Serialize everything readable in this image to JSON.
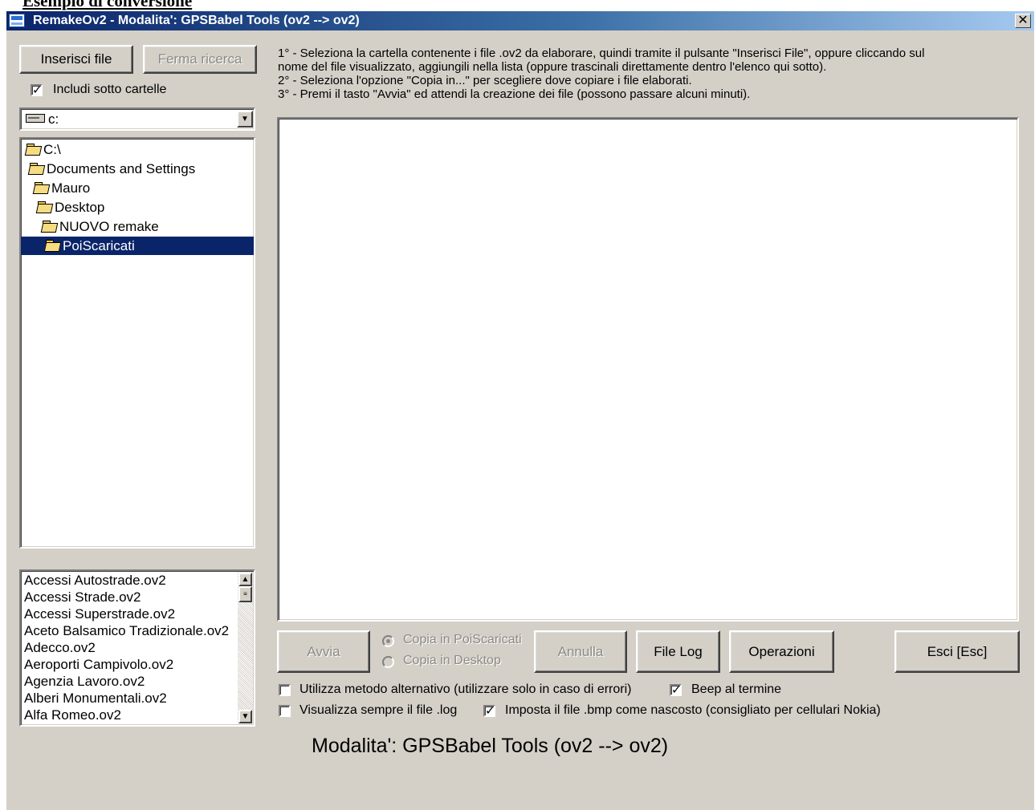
{
  "document": {
    "heading_fragment": "Esempio di conversione"
  },
  "window": {
    "title": "RemakeOv2 - Modalita': GPSBabel Tools (ov2 --> ov2)",
    "close_label": "✕"
  },
  "left_panel": {
    "insert_button": "Inserisci file",
    "stop_button": "Ferma ricerca",
    "include_subfolders": {
      "label": "Includi sotto cartelle",
      "checked": true
    },
    "drive_select": {
      "value": "c:",
      "options_visible": [
        "c:"
      ]
    },
    "folder_tree": [
      {
        "label": "C:\\",
        "selected": false
      },
      {
        "label": "Documents and Settings",
        "selected": false
      },
      {
        "label": "Mauro",
        "selected": false
      },
      {
        "label": "Desktop",
        "selected": false
      },
      {
        "label": "NUOVO remake",
        "selected": false
      },
      {
        "label": "PoiScaricati",
        "selected": true
      }
    ],
    "file_list": [
      "Accessi Autostrade.ov2",
      "Accessi Strade.ov2",
      "Accessi Superstrade.ov2",
      "Aceto Balsamico Tradizionale.ov2",
      "Adecco.ov2",
      "Aeroporti Campivolo.ov2",
      "Agenzia Lavoro.ov2",
      "Alberi Monumentali.ov2",
      "Alfa Romeo.ov2"
    ]
  },
  "instructions": {
    "line1a": "1° - Seleziona la cartella contenente i file .ov2 da elaborare, quindi tramite il pulsante \"Inserisci File\", oppure cliccando sul",
    "line1b": "nome del file visualizzato, aggiungili nella lista (oppure trascinali direttamente dentro l'elenco qui sotto).",
    "line2": "2° - Seleziona l'opzione \"Copia in...\" per scegliere dove copiare i file elaborati.",
    "line3": "3° - Premi il tasto \"Avvia\" ed attendi la creazione dei file (possono passare alcuni minuti)."
  },
  "actions": {
    "start": "Avvia",
    "copy_to_poiscaricati": "Copia in PoiScaricati",
    "copy_to_desktop": "Copia in Desktop",
    "cancel": "Annulla",
    "file_log": "File Log",
    "operations": "Operazioni",
    "exit": "Esci  [Esc]"
  },
  "options": {
    "alt_method": {
      "label": "Utilizza metodo alternativo (utilizzare solo in caso di errori)",
      "checked": false
    },
    "beep": {
      "label": "Beep al termine",
      "checked": true
    },
    "always_show_log": {
      "label": "Visualizza sempre il file .log",
      "checked": false
    },
    "hide_bmp": {
      "label": "Imposta il file .bmp come nascosto (consigliato per cellulari Nokia)",
      "checked": true
    }
  },
  "status": {
    "mode_text": "Modalita': GPSBabel Tools (ov2 --> ov2)"
  }
}
